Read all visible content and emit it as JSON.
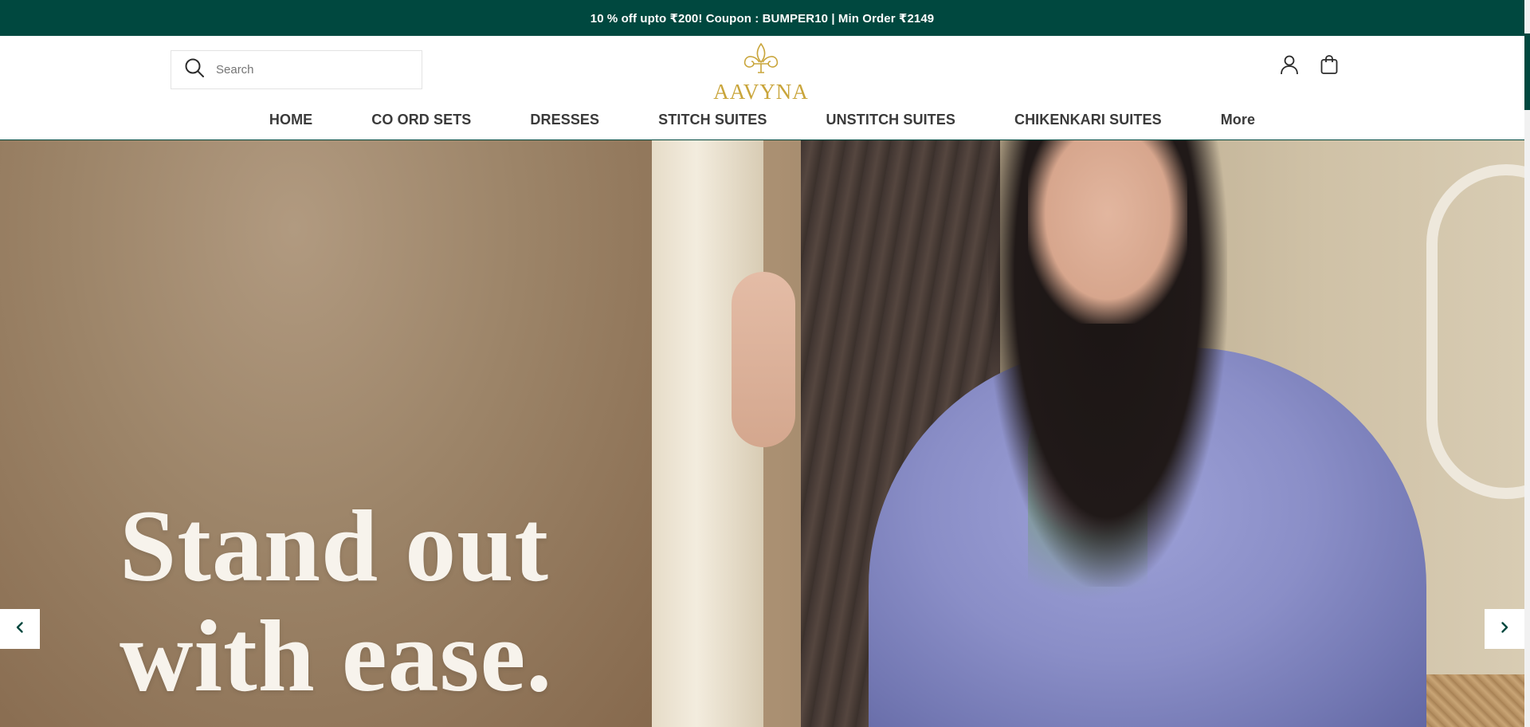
{
  "announcement": {
    "text": "10 % off upto ₹200! Coupon : BUMPER10 | Min Order ₹2149"
  },
  "header": {
    "search": {
      "placeholder": "Search",
      "value": "",
      "icon": "search-icon"
    },
    "logo": {
      "wordmark": "AAVYNA",
      "color": "#c9a53b",
      "icon": "fleur-de-lis-icon"
    },
    "account_icon": "user-icon",
    "cart_icon": "shopping-bag-icon"
  },
  "nav": {
    "items": [
      {
        "label": "HOME"
      },
      {
        "label": "CO ORD SETS"
      },
      {
        "label": "DRESSES"
      },
      {
        "label": "STITCH SUITES"
      },
      {
        "label": "UNSTITCH SUITES"
      },
      {
        "label": "CHIKENKARI SUITES"
      },
      {
        "label": "More"
      }
    ]
  },
  "hero": {
    "headline_line1": "Stand out",
    "headline_line2": "with ease.",
    "prev_icon": "chevron-left-icon",
    "next_icon": "chevron-right-icon"
  },
  "colors": {
    "brand": "#00483f",
    "logo_gold": "#c9a53b",
    "nav_text": "#3a3a3a"
  }
}
